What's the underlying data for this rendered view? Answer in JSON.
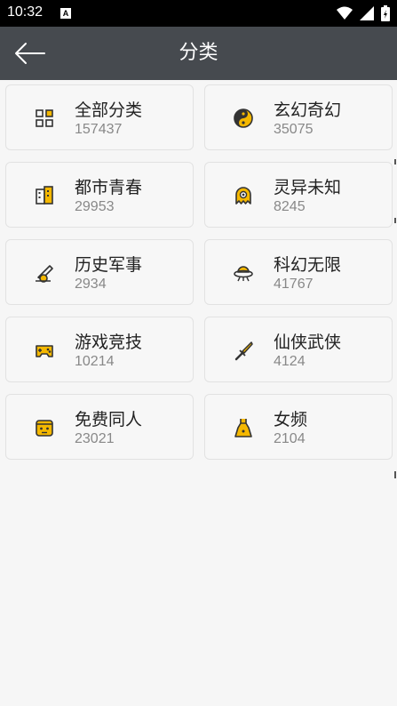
{
  "status_bar": {
    "time": "10:32",
    "notification_badge": "A"
  },
  "header": {
    "title": "分类",
    "back_icon": "arrow-left-icon"
  },
  "colors": {
    "accent": "#f5b800",
    "app_bar": "#464a4f",
    "status_bar": "#000000"
  },
  "categories": [
    {
      "name": "全部分类",
      "count": "157437",
      "icon": "grid-icon"
    },
    {
      "name": "玄幻奇幻",
      "count": "35075",
      "icon": "yin-yang-icon"
    },
    {
      "name": "都市青春",
      "count": "29953",
      "icon": "city-building-icon"
    },
    {
      "name": "灵异未知",
      "count": "8245",
      "icon": "ghost-icon"
    },
    {
      "name": "历史军事",
      "count": "2934",
      "icon": "cannon-icon"
    },
    {
      "name": "科幻无限",
      "count": "41767",
      "icon": "ufo-icon"
    },
    {
      "name": "游戏竞技",
      "count": "10214",
      "icon": "gamepad-icon"
    },
    {
      "name": "仙侠武侠",
      "count": "4124",
      "icon": "sword-icon"
    },
    {
      "name": "免费同人",
      "count": "23021",
      "icon": "mask-face-icon"
    },
    {
      "name": "女频",
      "count": "2104",
      "icon": "dress-icon"
    }
  ]
}
